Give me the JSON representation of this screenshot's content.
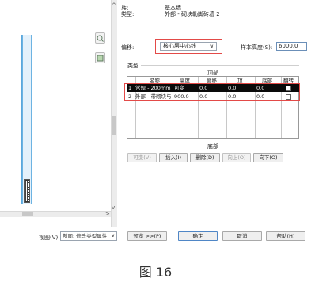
{
  "header": {
    "family_label": "族:",
    "family_value": "基本墙",
    "type_label": "类型:",
    "type_value": "外部 - 砌块勒脚砖墙 2",
    "offset_label": "偏移:",
    "offset_value": "核心层中心线",
    "sample_height_label": "样本高度(S):",
    "sample_height_value": "6000.0"
  },
  "type_section": {
    "label": "类型",
    "top_label": "顶部",
    "bottom_label": "底部",
    "columns": [
      "名称",
      "高度",
      "偏移",
      "顶",
      "底部",
      "翻转"
    ],
    "rows": [
      {
        "num": "1",
        "name": "常规 - 200mm",
        "height": "可变",
        "offset": "0.0",
        "top": "0.0",
        "bottom": "0.0"
      },
      {
        "num": "2",
        "name": "外部 - 带砌块与",
        "height": "900.0",
        "offset": "0.0",
        "top": "0.0",
        "bottom": "0.0"
      }
    ]
  },
  "buttons": {
    "variable": "可变(V)",
    "insert": "插入(I)",
    "delete": "删除(D)",
    "up": "向上(O)",
    "down": "向下(O)"
  },
  "footer": {
    "view_label": "视图(V):",
    "view_value": "剖面: 修改类型属性",
    "preview": "预览 >>(P)",
    "ok": "确定",
    "cancel": "取消",
    "help": "帮助(H)"
  },
  "preview_arrows": {
    "scroll_up": "^",
    "scroll_down": "v",
    "scroll_right": ">"
  },
  "caption": "图 16",
  "colors": {
    "highlight_box": "#e34a48",
    "selected_row": "#0a0a0a",
    "wall_outline": "#5aa7dc"
  }
}
